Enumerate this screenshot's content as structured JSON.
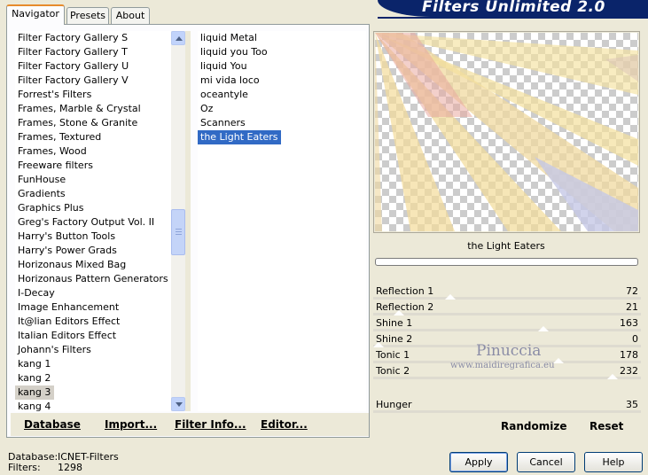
{
  "tabs": [
    {
      "label": "Navigator",
      "active": true
    },
    {
      "label": "Presets",
      "active": false
    },
    {
      "label": "About",
      "active": false
    }
  ],
  "header": {
    "title": "Filters Unlimited 2.0"
  },
  "categories": [
    "Filter Factory Gallery S",
    "Filter Factory Gallery T",
    "Filter Factory Gallery U",
    "Filter Factory Gallery V",
    "Forrest's Filters",
    "Frames, Marble & Crystal",
    "Frames, Stone & Granite",
    "Frames, Textured",
    "Frames, Wood",
    "Freeware filters",
    "FunHouse",
    "Gradients",
    "Graphics Plus",
    "Greg's Factory Output Vol. II",
    "Harry's Button Tools",
    "Harry's Power Grads",
    "Horizonaus Mixed Bag",
    "Horizonaus Pattern Generators",
    "I-Decay",
    "Image Enhancement",
    "It@lian Editors Effect",
    "Italian Editors Effect",
    "Johann's Filters",
    "kang 1",
    "kang 2",
    "kang 3",
    "kang 4"
  ],
  "selected_category": "kang 3",
  "filters": [
    "liquid Metal",
    "liquid you Too",
    "liquid You",
    "mi vida loco",
    "oceantyle",
    "Oz",
    "Scanners",
    "the Light Eaters"
  ],
  "selected_filter": "the Light Eaters",
  "preview": {
    "filter_name": "the Light Eaters",
    "progress": 0
  },
  "parameters": [
    {
      "label": "Reflection 1",
      "value": "72",
      "level": 0.28
    },
    {
      "label": "Reflection 2",
      "value": "21",
      "level": 0.08
    },
    {
      "label": "Shine 1",
      "value": "163",
      "level": 0.64
    },
    {
      "label": "Shine 2",
      "value": "0",
      "level": 0.0
    },
    {
      "label": "Tonic 1",
      "value": "178",
      "level": 0.7
    },
    {
      "label": "Tonic 2",
      "value": "232",
      "level": 0.91
    }
  ],
  "hunger": {
    "label": "Hunger",
    "value": "35"
  },
  "toolbar": {
    "database": "Database",
    "import": "Import...",
    "filter_info": "Filter Info...",
    "editor": "Editor...",
    "randomize": "Randomize",
    "reset": "Reset"
  },
  "status": {
    "database_label": "Database:",
    "database_value": "ICNET-Filters",
    "filters_label": "Filters:",
    "filters_value": "1298"
  },
  "buttons": {
    "apply": "Apply",
    "cancel": "Cancel",
    "help": "Help"
  },
  "watermark": {
    "name": "Pinuccia",
    "site": "www.maidiregrafica.eu"
  },
  "colors": {
    "accent": "#0a246a",
    "selection": "#316ac5",
    "tab_highlight": "#e68b2c"
  }
}
